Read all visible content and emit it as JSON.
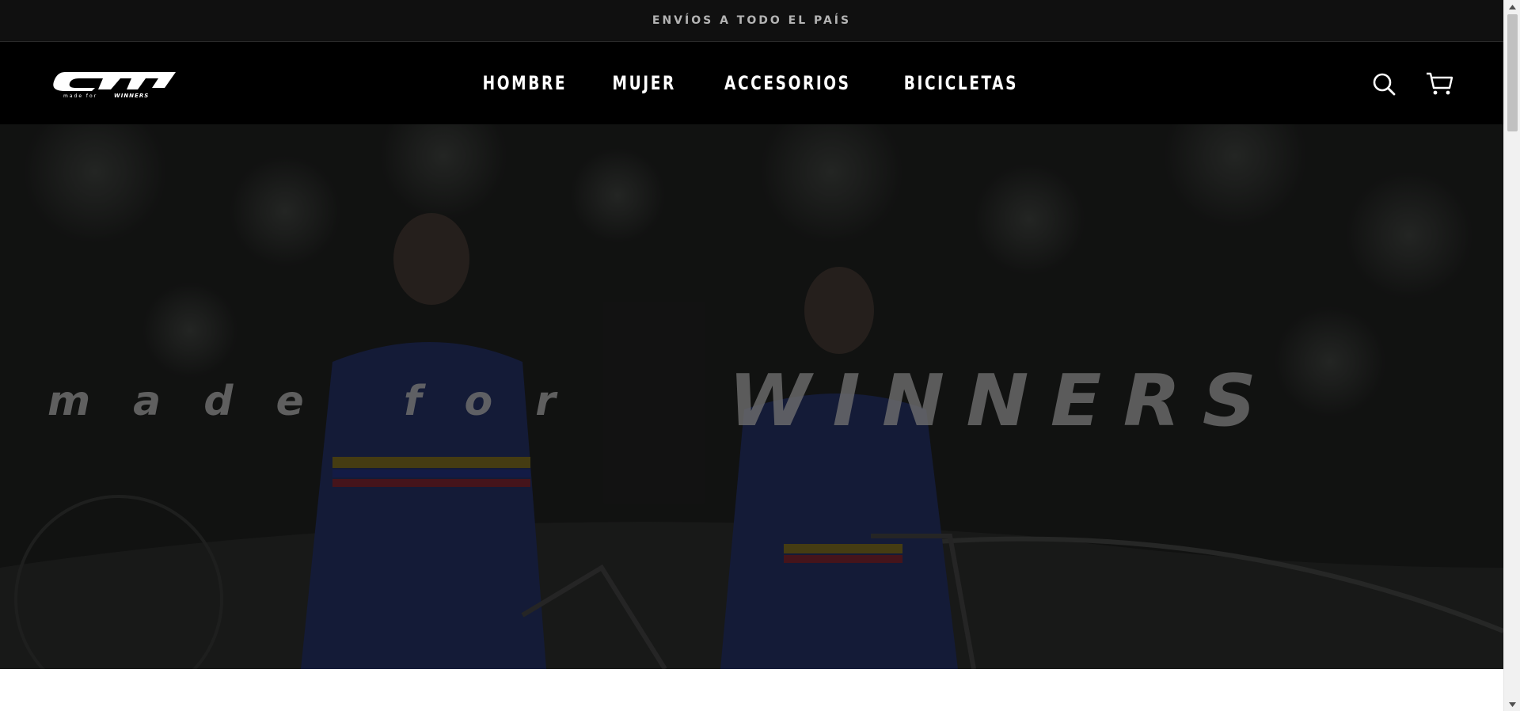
{
  "announcement": {
    "text": "ENVÍOS A TODO EL PAÍS"
  },
  "brand": {
    "logo_text": "GW",
    "logo_subtext": "made for WINNERS"
  },
  "nav": {
    "items": [
      {
        "label": "HOMBRE"
      },
      {
        "label": "MUJER"
      },
      {
        "label": "ACCESORIOS"
      },
      {
        "label": "BICICLETAS"
      }
    ]
  },
  "header_icons": {
    "search": "search-icon",
    "cart": "cart-icon"
  },
  "hero": {
    "tagline_left": "made for",
    "tagline_right": "WINNERS"
  },
  "colors": {
    "announcement_bg": "#101010",
    "header_bg": "#000000",
    "nav_text": "#ffffff",
    "hero_overlay": "#161716"
  }
}
